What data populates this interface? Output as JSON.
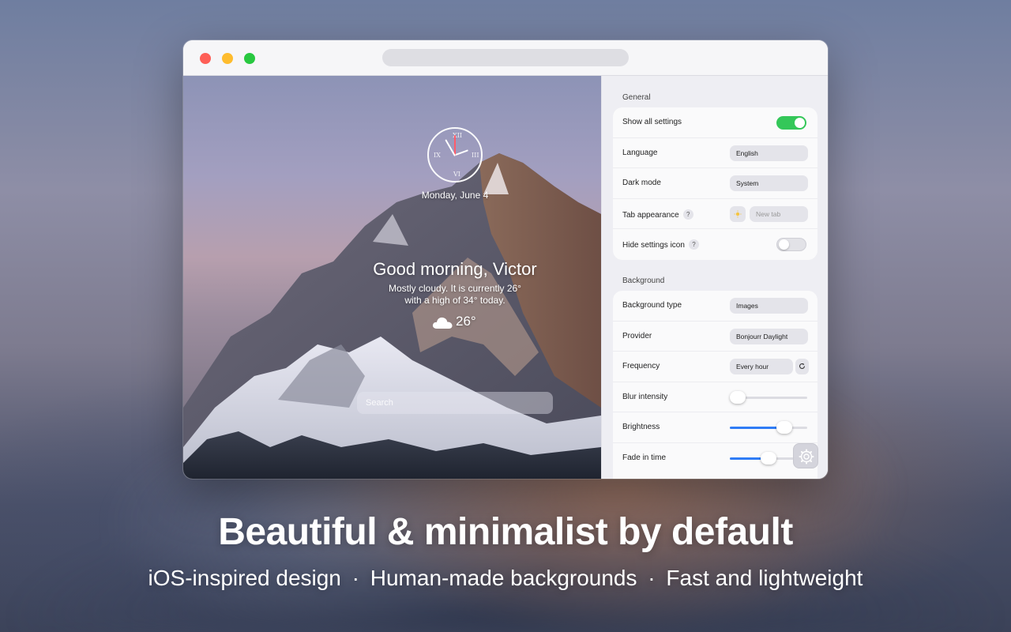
{
  "marketing": {
    "headline": "Beautiful & minimalist by default",
    "features": [
      "iOS-inspired design",
      "Human-made backgrounds",
      "Fast and lightweight"
    ],
    "separator": "·"
  },
  "preview": {
    "clock_numerals": {
      "top": "XII",
      "right": "III",
      "bottom": "VI",
      "left": "IX"
    },
    "date": "Monday, June 4",
    "greeting": "Good morning, Victor",
    "description_line1": "Mostly cloudy. It is currently 26°",
    "description_line2": "with a high of 34° today.",
    "weather_temp": "26°",
    "weather_icon": "cloud-icon",
    "search_placeholder": "Search"
  },
  "settings": {
    "general": {
      "title": "General",
      "show_all_settings": {
        "label": "Show all settings",
        "value": true
      },
      "language": {
        "label": "Language",
        "value": "English"
      },
      "dark_mode": {
        "label": "Dark mode",
        "value": "System"
      },
      "tab_appearance": {
        "label": "Tab appearance",
        "help": "?",
        "icon": "sun-icon",
        "value": "New tab"
      },
      "hide_settings_icon": {
        "label": "Hide settings icon",
        "help": "?",
        "value": false
      }
    },
    "background": {
      "title": "Background",
      "background_type": {
        "label": "Background type",
        "value": "Images"
      },
      "provider": {
        "label": "Provider",
        "value": "Bonjourr Daylight"
      },
      "frequency": {
        "label": "Frequency",
        "value": "Every hour",
        "refresh_icon": "refresh-icon"
      },
      "blur_intensity": {
        "label": "Blur intensity",
        "value": 0
      },
      "brightness": {
        "label": "Brightness",
        "value": 0.75
      },
      "fade_in_time": {
        "label": "Fade in time",
        "value": 0.5
      }
    }
  },
  "colors": {
    "toggle_on": "#34c759",
    "slider_accent": "#2f7cf6",
    "traffic_red": "#fe5f57",
    "traffic_yellow": "#febc2e",
    "traffic_green": "#28c840"
  }
}
